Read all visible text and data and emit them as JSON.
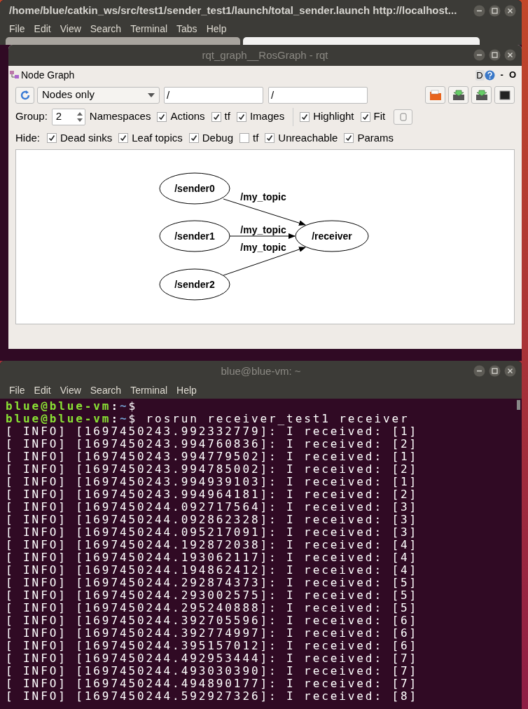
{
  "back_terminal": {
    "title": "/home/blue/catkin_ws/src/test1/sender_test1/launch/total_sender.launch http://localhost...",
    "menu": [
      "File",
      "Edit",
      "View",
      "Search",
      "Terminal",
      "Tabs",
      "Help"
    ]
  },
  "rqt": {
    "title": "rqt_graph__RosGraph - rqt",
    "plugin_title": "Node Graph",
    "plugin_buttons": [
      "D"
    ],
    "edge_marks": [
      "-",
      "O"
    ],
    "mode": "Nodes only",
    "filter_nodes": "/",
    "filter_topics": "/",
    "group_label": "Group:",
    "group_value": "2",
    "namespaces_label": "Namespaces",
    "options": [
      {
        "label": "Actions",
        "checked": true
      },
      {
        "label": "tf",
        "checked": true
      },
      {
        "label": "Images",
        "checked": true
      }
    ],
    "view_options": [
      {
        "label": "Highlight",
        "checked": true
      },
      {
        "label": "Fit",
        "checked": true
      }
    ],
    "hide_label": "Hide:",
    "hide": [
      {
        "label": "Dead sinks",
        "checked": true
      },
      {
        "label": "Leaf topics",
        "checked": true
      },
      {
        "label": "Debug",
        "checked": true
      },
      {
        "label": "tf",
        "checked": false
      },
      {
        "label": "Unreachable",
        "checked": true
      },
      {
        "label": "Params",
        "checked": true
      }
    ],
    "graph": {
      "nodes": [
        {
          "label": "/sender0"
        },
        {
          "label": "/sender1"
        },
        {
          "label": "/sender2"
        },
        {
          "label": "/receiver"
        }
      ],
      "edges": [
        {
          "label": "/my_topic"
        },
        {
          "label": "/my_topic"
        },
        {
          "label": "/my_topic"
        }
      ]
    }
  },
  "terminal": {
    "title": "blue@blue-vm: ~",
    "menu": [
      "File",
      "Edit",
      "View",
      "Search",
      "Terminal",
      "Help"
    ],
    "lines": [
      {
        "kind": "prompt",
        "user": "blue@blue-vm",
        "sep": ":",
        "path": "~",
        "dollar": "$"
      },
      {
        "kind": "prompt",
        "user": "blue@blue-vm",
        "sep": ":",
        "path": "~",
        "dollar": "$",
        "command": "rosrun receiver_test1 receiver"
      },
      {
        "kind": "output",
        "text": "[ INFO] [1697450243.992332779]: I received: [1]"
      },
      {
        "kind": "output",
        "text": "[ INFO] [1697450243.994760836]: I received: [2]"
      },
      {
        "kind": "output",
        "text": "[ INFO] [1697450243.994779502]: I received: [1]"
      },
      {
        "kind": "output",
        "text": "[ INFO] [1697450243.994785002]: I received: [2]"
      },
      {
        "kind": "output",
        "text": "[ INFO] [1697450243.994939103]: I received: [1]"
      },
      {
        "kind": "output",
        "text": "[ INFO] [1697450243.994964181]: I received: [2]"
      },
      {
        "kind": "output",
        "text": "[ INFO] [1697450244.092717564]: I received: [3]"
      },
      {
        "kind": "output",
        "text": "[ INFO] [1697450244.092862328]: I received: [3]"
      },
      {
        "kind": "output",
        "text": "[ INFO] [1697450244.095217091]: I received: [3]"
      },
      {
        "kind": "output",
        "text": "[ INFO] [1697450244.192872038]: I received: [4]"
      },
      {
        "kind": "output",
        "text": "[ INFO] [1697450244.193062117]: I received: [4]"
      },
      {
        "kind": "output",
        "text": "[ INFO] [1697450244.194862412]: I received: [4]"
      },
      {
        "kind": "output",
        "text": "[ INFO] [1697450244.292874373]: I received: [5]"
      },
      {
        "kind": "output",
        "text": "[ INFO] [1697450244.293002575]: I received: [5]"
      },
      {
        "kind": "output",
        "text": "[ INFO] [1697450244.295240888]: I received: [5]"
      },
      {
        "kind": "output",
        "text": "[ INFO] [1697450244.392705596]: I received: [6]"
      },
      {
        "kind": "output",
        "text": "[ INFO] [1697450244.392774997]: I received: [6]"
      },
      {
        "kind": "output",
        "text": "[ INFO] [1697450244.395157012]: I received: [6]"
      },
      {
        "kind": "output",
        "text": "[ INFO] [1697450244.492953444]: I received: [7]"
      },
      {
        "kind": "output",
        "text": "[ INFO] [1697450244.493030390]: I received: [7]"
      },
      {
        "kind": "output",
        "text": "[ INFO] [1697450244.494890177]: I received: [7]"
      },
      {
        "kind": "output",
        "text": "[ INFO] [1697450244.592927326]: I received: [8]"
      }
    ]
  }
}
